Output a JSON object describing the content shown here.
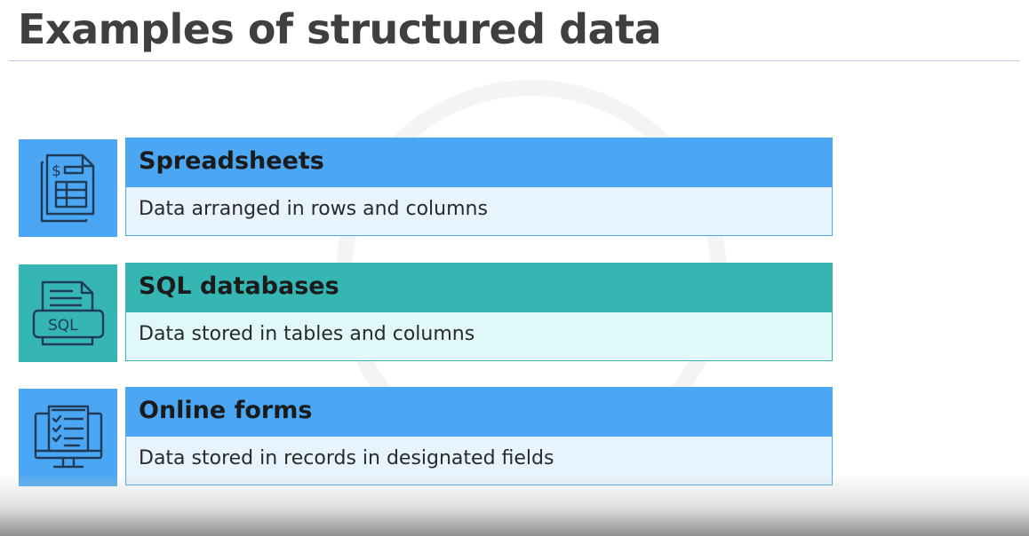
{
  "slide": {
    "title": "Examples of structured data"
  },
  "items": [
    {
      "heading": "Spreadsheets",
      "description": "Data arranged in rows and columns",
      "icon": "spreadsheet-icon",
      "color": "#4ba7f3"
    },
    {
      "heading": "SQL databases",
      "description": "Data stored in tables and columns",
      "icon": "sql-database-icon",
      "color": "#36b6b3",
      "icon_label": "SQL"
    },
    {
      "heading": "Online forms",
      "description": "Data stored in records in designated fields",
      "icon": "online-form-icon",
      "color": "#4ba7f3"
    }
  ]
}
